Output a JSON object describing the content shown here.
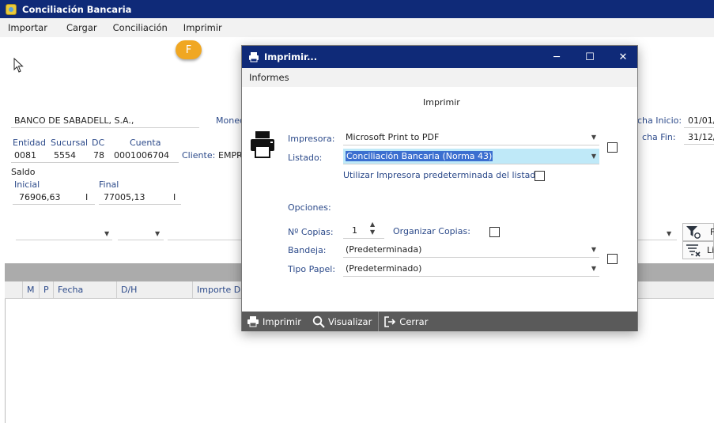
{
  "app": {
    "title": "Conciliación Bancaria"
  },
  "menu": {
    "items": [
      "Importar",
      "Cargar",
      "Conciliación",
      "Imprimir"
    ],
    "hint_badge": "F"
  },
  "bank": {
    "name": "BANCO DE SABADELL, S.A.,",
    "moneda_label": "Moned",
    "entidad_label": "Entidad",
    "entidad": "0081",
    "sucursal_label": "Sucursal",
    "sucursal": "5554",
    "dc_label": "DC",
    "dc": "78",
    "cuenta_label": "Cuenta",
    "cuenta": "0001006704",
    "cliente_label": "Cliente:",
    "cliente": "EMPR",
    "fecha_inicio_label": "cha Inicio:",
    "fecha_inicio": "01/01/",
    "fecha_fin_label": "cha Fin:",
    "fecha_fin": "31/12/"
  },
  "saldo": {
    "label": "Saldo",
    "inicial_label": "Inicial",
    "inicial": "76906,63",
    "inicial_suffix": "I",
    "final_label": "Final",
    "final": "77005,13",
    "final_suffix": "I"
  },
  "filters": {
    "right_label_1": "F",
    "right_label_2": "Li"
  },
  "grid": {
    "columns": [
      "M",
      "P",
      "Fecha",
      "D/H",
      "Importe D"
    ]
  },
  "dialog": {
    "title": "Imprimir...",
    "menu": "Informes",
    "section_title": "Imprimir",
    "impresora_label": "Impresora:",
    "impresora": "Microsoft Print to PDF",
    "listado_label": "Listado:",
    "listado": "Conciliación Bancaria (Norma 43)",
    "default_printer_label": "Utilizar Impresora predeterminada del listado:",
    "opciones_label": "Opciones:",
    "copias_label": "Nº Copias:",
    "copias": "1",
    "organizar_label": "Organizar Copias:",
    "bandeja_label": "Bandeja:",
    "bandeja": "(Predeterminada)",
    "tipo_papel_label": "Tipo Papel:",
    "tipo_papel": "(Predeterminado)",
    "footer": {
      "imprimir": "Imprimir",
      "visualizar": "Visualizar",
      "cerrar": "Cerrar"
    }
  },
  "colors": {
    "titlebar": "#0f2a78",
    "accent_blue": "#2c4a8a",
    "badge": "#f0a722",
    "footer": "#5a5a5a",
    "selection": "#bfe9f8"
  }
}
